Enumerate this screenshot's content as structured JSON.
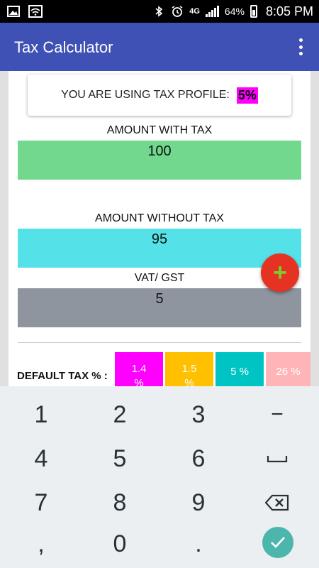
{
  "status_bar": {
    "network": "4G",
    "battery": "64%",
    "time": "8:05 PM",
    "icons": [
      "image-icon",
      "wifi-icon",
      "bluetooth-icon",
      "alarm-icon",
      "signal-icon",
      "battery-icon"
    ]
  },
  "app_bar": {
    "title": "Tax Calculator",
    "menu_icon": "overflow-menu-icon",
    "color": "#3f51b5"
  },
  "profile": {
    "label": "YOU ARE USING TAX PROFILE:",
    "value": "5%"
  },
  "fields": {
    "amount_with_tax": {
      "label": "AMOUNT WITH TAX",
      "value": "100",
      "color": "#71d88e"
    },
    "amount_without_tax": {
      "label": "AMOUNT WITHOUT TAX",
      "value": "95",
      "color": "#54e1e8"
    },
    "vat_gst": {
      "label": "VAT/ GST",
      "value": "5",
      "color": "#8f959f"
    }
  },
  "fab": {
    "label": "+",
    "icon": "add-icon",
    "color": "#e53223"
  },
  "default_tax": {
    "label": "DEFAULT TAX % :",
    "chips": [
      {
        "line1": "1.4",
        "line2": "%",
        "color": "#ff00ff"
      },
      {
        "line1": "1.5",
        "line2": "%",
        "color": "#ffc000"
      },
      {
        "line1": "5 %",
        "line2": "",
        "color": "#00c4c4"
      },
      {
        "line1": "26 %",
        "line2": "",
        "color": "#ffb4b8"
      }
    ]
  },
  "keyboard": {
    "keys": [
      "1",
      "2",
      "3",
      "−",
      "4",
      "5",
      "6",
      "␣",
      "7",
      "8",
      "9",
      "⌫",
      ",",
      "0",
      ".",
      "✓"
    ],
    "space_icon": "space-icon",
    "backspace_icon": "backspace-icon",
    "done_icon": "check-icon"
  }
}
